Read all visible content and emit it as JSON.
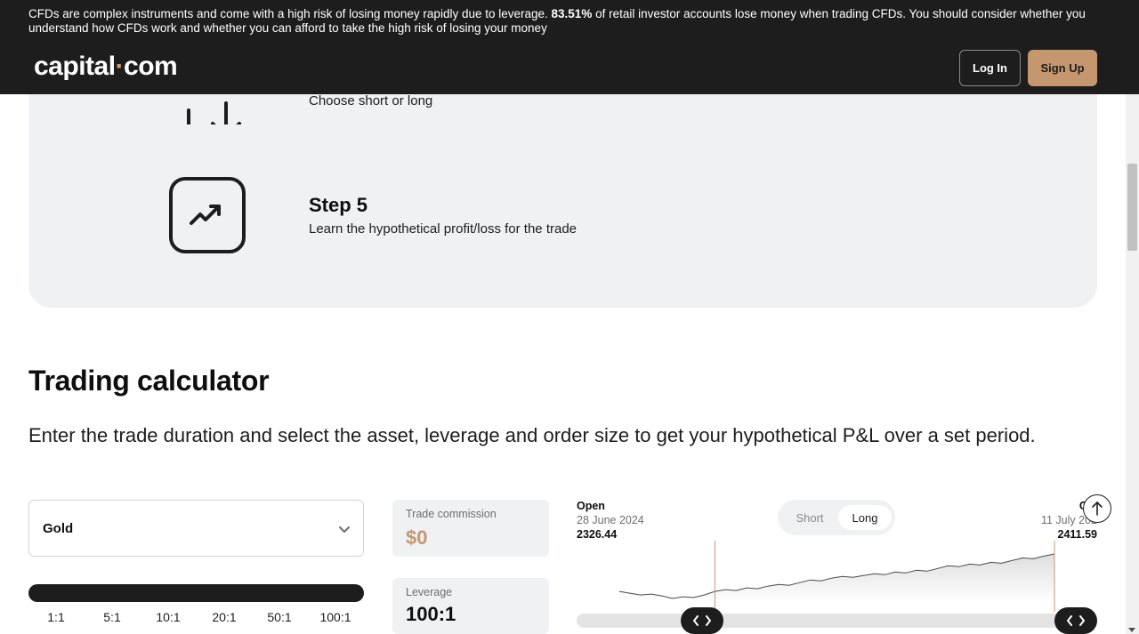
{
  "header": {
    "risk_prefix": "CFDs are complex instruments and come with a high risk of losing money rapidly due to leverage. ",
    "risk_percent": "83.51%",
    "risk_suffix": " of retail investor accounts lose money when trading CFDs. You should consider whether you understand how CFDs work and whether you can afford to take the high risk of losing your money",
    "logo_left": "capital",
    "logo_dot": "·",
    "logo_right": "com",
    "login_label": "Log In",
    "signup_label": "Sign Up"
  },
  "steps": {
    "step4_desc": "Choose short or long",
    "step5_title": "Step 5",
    "step5_desc": "Learn the hypothetical profit/loss for the trade",
    "step4_icon": "arrows-up-down-icon",
    "step5_icon": "trending-up-icon"
  },
  "calculator": {
    "title": "Trading calculator",
    "subtitle": "Enter the trade duration and select the asset, leverage and order size to get your hypothetical P&L over a set period.",
    "asset_value": "Gold",
    "leverage_options": [
      "1:1",
      "5:1",
      "10:1",
      "20:1",
      "50:1",
      "100:1"
    ],
    "commission_label": "Trade commission",
    "commission_value": "$0",
    "leverage_label": "Leverage",
    "leverage_value": "100:1",
    "open_label": "Open",
    "open_date": "28 June 2024",
    "open_value": "2326.44",
    "close_label": "Clo",
    "close_date": "11 July 202",
    "close_value": "2411.59",
    "direction_options": [
      "Short",
      "Long"
    ],
    "direction_selected": "Long"
  },
  "chart_data": {
    "type": "area",
    "y": [
      2326,
      2322,
      2318,
      2320,
      2316,
      2310,
      2314,
      2312,
      2318,
      2326,
      2330,
      2328,
      2334,
      2332,
      2338,
      2342,
      2340,
      2346,
      2352,
      2350,
      2356,
      2360,
      2358,
      2362,
      2366,
      2364,
      2370,
      2368,
      2374,
      2372,
      2378,
      2384,
      2382,
      2388,
      2386,
      2392,
      2390,
      2396,
      2402,
      2400,
      2406,
      2411
    ],
    "selected_start_index": 9,
    "selected_end_index": 41
  },
  "colors": {
    "header_bg": "#1d1d1d",
    "accent": "#c5976f",
    "panel_bg": "#f0f1f3",
    "text": "#0e0e0e"
  }
}
